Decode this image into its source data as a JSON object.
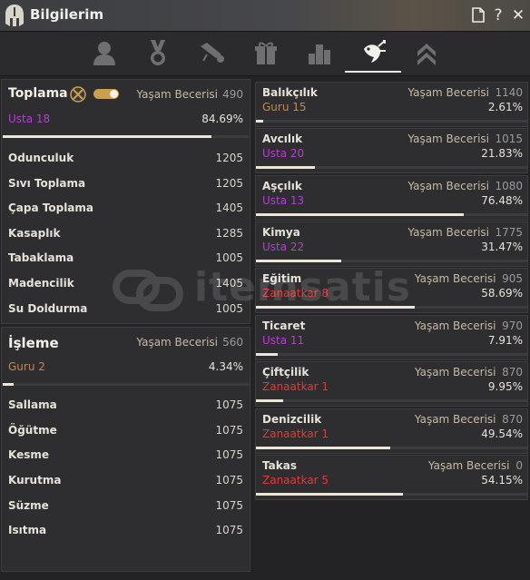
{
  "window": {
    "title": "Bilgilerim"
  },
  "tabs": [
    {
      "icon": "person-icon"
    },
    {
      "icon": "medal-icon"
    },
    {
      "icon": "scroll-icon"
    },
    {
      "icon": "gift-icon"
    },
    {
      "icon": "stats-icon"
    },
    {
      "icon": "fish-icon",
      "active": true
    },
    {
      "icon": "rank-chevron-icon"
    }
  ],
  "colors": {
    "guru": "#c4874a",
    "usta": "#b33fd0",
    "zanaatkar": "#dd3b3b",
    "bar_fill": "#ece6d8"
  },
  "toplama": {
    "title": "Toplama",
    "life_skill_label": "Yaşam Becerisi",
    "life_skill_value": "490",
    "rank": "Usta 18",
    "percent": "84.69%",
    "progress": 0.8469,
    "items": [
      {
        "name": "Odunculuk",
        "value": "1205"
      },
      {
        "name": "Sıvı Toplama",
        "value": "1205"
      },
      {
        "name": "Çapa Toplama",
        "value": "1405"
      },
      {
        "name": "Kasaplık",
        "value": "1285"
      },
      {
        "name": "Tabaklama",
        "value": "1005"
      },
      {
        "name": "Madencilik",
        "value": "1405"
      },
      {
        "name": "Su Doldurma",
        "value": "1005"
      }
    ]
  },
  "isleme": {
    "title": "İşleme",
    "life_skill_label": "Yaşam Becerisi",
    "life_skill_value": "560",
    "rank": "Guru 2",
    "percent": "4.34%",
    "progress": 0.0434,
    "items": [
      {
        "name": "Sallama",
        "value": "1075"
      },
      {
        "name": "Öğütme",
        "value": "1075"
      },
      {
        "name": "Kesme",
        "value": "1075"
      },
      {
        "name": "Kurutma",
        "value": "1075"
      },
      {
        "name": "Süzme",
        "value": "1075"
      },
      {
        "name": "Isıtma",
        "value": "1075"
      }
    ]
  },
  "skills": [
    {
      "name": "Balıkçılık",
      "life_skill_label": "Yaşam Becerisi",
      "life_skill_value": "1140",
      "rank": "Guru 15",
      "rank_type": "guru",
      "percent": "2.61%",
      "progress": 0.0261
    },
    {
      "name": "Avcılık",
      "life_skill_label": "Yaşam Becerisi",
      "life_skill_value": "1015",
      "rank": "Usta 20",
      "rank_type": "usta",
      "percent": "21.83%",
      "progress": 0.2183
    },
    {
      "name": "Aşçılık",
      "life_skill_label": "Yaşam Becerisi",
      "life_skill_value": "1080",
      "rank": "Usta 13",
      "rank_type": "usta",
      "percent": "76.48%",
      "progress": 0.7648
    },
    {
      "name": "Kimya",
      "life_skill_label": "Yaşam Becerisi",
      "life_skill_value": "1775",
      "rank": "Usta 22",
      "rank_type": "usta",
      "percent": "31.47%",
      "progress": 0.3147
    },
    {
      "name": "Eğitim",
      "life_skill_label": "Yaşam Becerisi",
      "life_skill_value": "905",
      "rank": "Zanaatkar 8",
      "rank_type": "zan",
      "percent": "58.69%",
      "progress": 0.5869
    },
    {
      "name": "Ticaret",
      "life_skill_label": "Yaşam Becerisi",
      "life_skill_value": "970",
      "rank": "Usta 11",
      "rank_type": "usta",
      "percent": "7.91%",
      "progress": 0.0791
    },
    {
      "name": "Çiftçilik",
      "life_skill_label": "Yaşam Becerisi",
      "life_skill_value": "870",
      "rank": "Zanaatkar 1",
      "rank_type": "zan",
      "percent": "9.95%",
      "progress": 0.0995
    },
    {
      "name": "Denizcilik",
      "life_skill_label": "Yaşam Becerisi",
      "life_skill_value": "870",
      "rank": "Zanaatkar 1",
      "rank_type": "zan",
      "percent": "49.54%",
      "progress": 0.4954
    },
    {
      "name": "Takas",
      "life_skill_label": "Yaşam Becerisi",
      "life_skill_value": "0",
      "rank": "Zanaatkar 5",
      "rank_type": "zan",
      "percent": "54.15%",
      "progress": 0.5415
    }
  ],
  "watermark": {
    "text": "itemsatis"
  }
}
